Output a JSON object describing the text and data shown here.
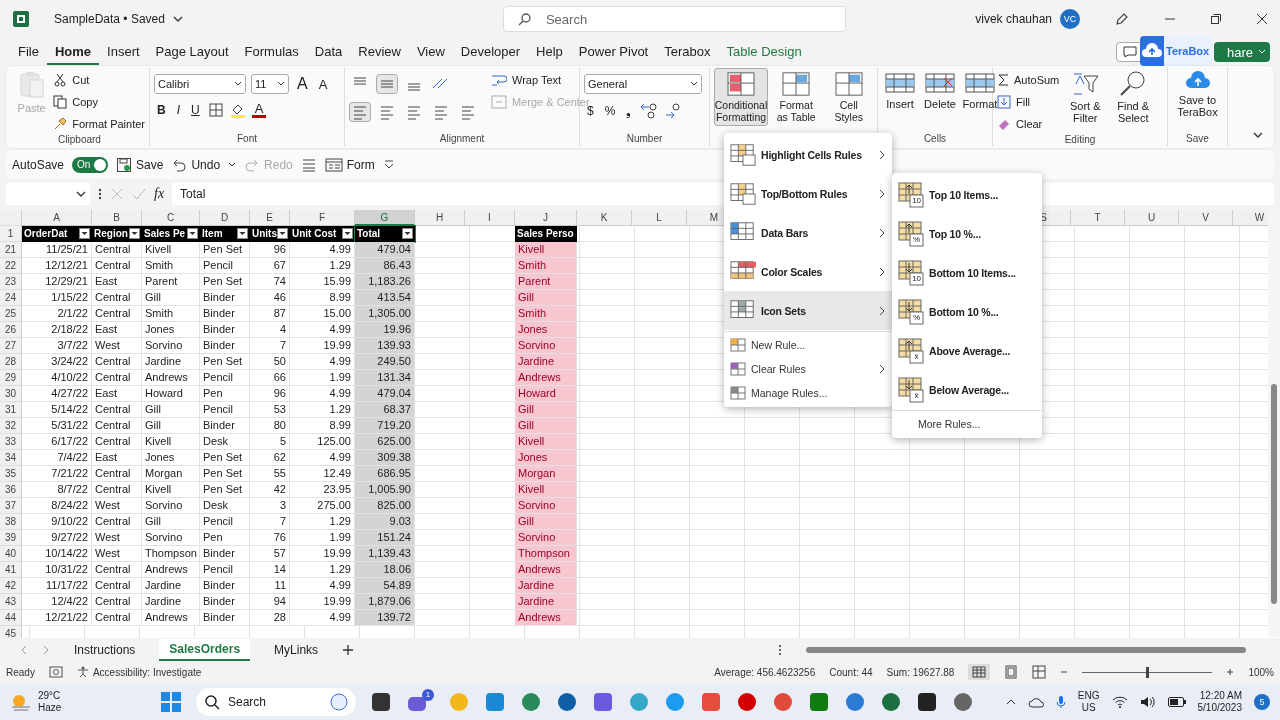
{
  "title_bar": {
    "file_name": "SampleData • Saved",
    "search_placeholder": "Search",
    "user_name": "vivek chauhan",
    "avatar_initials": "VC"
  },
  "ribbon_tabs": [
    {
      "label": "File",
      "selected": false,
      "kind": "normal"
    },
    {
      "label": "Home",
      "selected": true,
      "kind": "normal"
    },
    {
      "label": "Insert",
      "selected": false,
      "kind": "normal"
    },
    {
      "label": "Page Layout",
      "selected": false,
      "kind": "normal"
    },
    {
      "label": "Formulas",
      "selected": false,
      "kind": "normal"
    },
    {
      "label": "Data",
      "selected": false,
      "kind": "normal"
    },
    {
      "label": "Review",
      "selected": false,
      "kind": "normal"
    },
    {
      "label": "View",
      "selected": false,
      "kind": "normal"
    },
    {
      "label": "Developer",
      "selected": false,
      "kind": "normal"
    },
    {
      "label": "Help",
      "selected": false,
      "kind": "normal"
    },
    {
      "label": "Power Pivot",
      "selected": false,
      "kind": "normal"
    },
    {
      "label": "Terabox",
      "selected": false,
      "kind": "normal"
    },
    {
      "label": "Table Design",
      "selected": false,
      "kind": "contextual"
    }
  ],
  "share_button": {
    "label": "hare"
  },
  "terabox_badge": {
    "label": "TeraBox"
  },
  "ribbon": {
    "clipboard": {
      "paste": {
        "label": "Paste",
        "disabled": true
      },
      "cut": "Cut",
      "copy": "Copy",
      "format_painter": "Format Painter",
      "label": "Clipboard"
    },
    "font": {
      "family": "Calibri",
      "size": "11",
      "grow": "A",
      "shrink": "A",
      "format_buttons": [
        "B",
        "I",
        "U"
      ],
      "font_color": "A",
      "label": "Font"
    },
    "alignment": {
      "wrap_text": "Wrap Text",
      "merge_center": {
        "label": "Merge & Center",
        "disabled": true
      },
      "label": "Alignment"
    },
    "number": {
      "format": "General",
      "currency": "$",
      "percent": "%",
      "comma": "❟",
      "label": "Number"
    },
    "styles": [
      {
        "label": "Conditional Formatting",
        "selected": true
      },
      {
        "label": "Format as Table",
        "selected": false
      },
      {
        "label": "Cell Styles",
        "selected": false
      }
    ],
    "cells": {
      "buttons": [
        "Insert",
        "Delete",
        "Format"
      ],
      "label": "Cells"
    },
    "editing": {
      "autosum": "AutoSum",
      "fill": "Fill",
      "clear": "Clear",
      "sort_filter": "Sort & Filter",
      "find_select": "Find & Select",
      "label": "Editing"
    },
    "save": {
      "button": "Save to TeraBox",
      "label": "Save"
    }
  },
  "quick_access": {
    "autosave_label": "AutoSave",
    "autosave": {
      "on": true,
      "label": "On"
    },
    "save": "Save",
    "undo": "Undo",
    "redo": {
      "label": "Redo",
      "disabled": true
    },
    "form": "Form"
  },
  "formula_bar": {
    "fx": "fx",
    "content": "Total"
  },
  "sheet": {
    "columns_left": [
      {
        "letter": "A",
        "selected": false
      },
      {
        "letter": "B",
        "selected": false
      },
      {
        "letter": "C",
        "selected": false
      },
      {
        "letter": "D",
        "selected": false
      },
      {
        "letter": "E",
        "selected": false
      },
      {
        "letter": "F",
        "selected": false
      },
      {
        "letter": "G",
        "selected": true
      },
      {
        "letter": "H",
        "selected": false
      },
      {
        "letter": "I",
        "selected": false
      },
      {
        "letter": "J",
        "selected": false
      },
      {
        "letter": "K",
        "selected": false
      },
      {
        "letter": "L",
        "selected": false
      },
      {
        "letter": "M",
        "selected": false
      }
    ],
    "columns_right": [
      {
        "letter": "S",
        "selected": false
      },
      {
        "letter": "T",
        "selected": false
      },
      {
        "letter": "U",
        "selected": false
      },
      {
        "letter": "V",
        "selected": false
      },
      {
        "letter": "W",
        "selected": false
      }
    ],
    "header_row": "1",
    "headers": [
      "OrderDat",
      "Region",
      "Sales Pe",
      "Item",
      "Units",
      "Unit Cost",
      "Total"
    ],
    "side_header": "Sales Perso",
    "rows": [
      {
        "n": "21",
        "cells": [
          "11/25/21",
          "Central",
          "Kivell",
          "Pen Set",
          "96",
          "4.99",
          "479.04"
        ],
        "side": "Kivell"
      },
      {
        "n": "22",
        "cells": [
          "12/12/21",
          "Central",
          "Smith",
          "Pencil",
          "67",
          "1.29",
          "86.43"
        ],
        "side": "Smith"
      },
      {
        "n": "23",
        "cells": [
          "12/29/21",
          "East",
          "Parent",
          "Pen Set",
          "74",
          "15.99",
          "1,183.26"
        ],
        "side": "Parent"
      },
      {
        "n": "24",
        "cells": [
          "1/15/22",
          "Central",
          "Gill",
          "Binder",
          "46",
          "8.99",
          "413.54"
        ],
        "side": "Gill"
      },
      {
        "n": "25",
        "cells": [
          "2/1/22",
          "Central",
          "Smith",
          "Binder",
          "87",
          "15.00",
          "1,305.00"
        ],
        "side": "Smith"
      },
      {
        "n": "26",
        "cells": [
          "2/18/22",
          "East",
          "Jones",
          "Binder",
          "4",
          "4.99",
          "19.96"
        ],
        "side": "Jones"
      },
      {
        "n": "27",
        "cells": [
          "3/7/22",
          "West",
          "Sorvino",
          "Binder",
          "7",
          "19.99",
          "139.93"
        ],
        "side": "Sorvino"
      },
      {
        "n": "28",
        "cells": [
          "3/24/22",
          "Central",
          "Jardine",
          "Pen Set",
          "50",
          "4.99",
          "249.50"
        ],
        "side": "Jardine"
      },
      {
        "n": "29",
        "cells": [
          "4/10/22",
          "Central",
          "Andrews",
          "Pencil",
          "66",
          "1.99",
          "131.34"
        ],
        "side": "Andrews"
      },
      {
        "n": "30",
        "cells": [
          "4/27/22",
          "East",
          "Howard",
          "Pen",
          "96",
          "4.99",
          "479.04"
        ],
        "side": "Howard"
      },
      {
        "n": "31",
        "cells": [
          "5/14/22",
          "Central",
          "Gill",
          "Pencil",
          "53",
          "1.29",
          "68.37"
        ],
        "side": "Gill"
      },
      {
        "n": "32",
        "cells": [
          "5/31/22",
          "Central",
          "Gill",
          "Binder",
          "80",
          "8.99",
          "719.20"
        ],
        "side": "Gill"
      },
      {
        "n": "33",
        "cells": [
          "6/17/22",
          "Central",
          "Kivell",
          "Desk",
          "5",
          "125.00",
          "625.00"
        ],
        "side": "Kivell"
      },
      {
        "n": "34",
        "cells": [
          "7/4/22",
          "East",
          "Jones",
          "Pen Set",
          "62",
          "4.99",
          "309.38"
        ],
        "side": "Jones"
      },
      {
        "n": "35",
        "cells": [
          "7/21/22",
          "Central",
          "Morgan",
          "Pen Set",
          "55",
          "12.49",
          "686.95"
        ],
        "side": "Morgan"
      },
      {
        "n": "36",
        "cells": [
          "8/7/22",
          "Central",
          "Kivell",
          "Pen Set",
          "42",
          "23.95",
          "1,005.90"
        ],
        "side": "Kivell"
      },
      {
        "n": "37",
        "cells": [
          "8/24/22",
          "West",
          "Sorvino",
          "Desk",
          "3",
          "275.00",
          "825.00"
        ],
        "side": "Sorvino"
      },
      {
        "n": "38",
        "cells": [
          "9/10/22",
          "Central",
          "Gill",
          "Pencil",
          "7",
          "1.29",
          "9.03"
        ],
        "side": "Gill"
      },
      {
        "n": "39",
        "cells": [
          "9/27/22",
          "West",
          "Sorvino",
          "Pen",
          "76",
          "1.99",
          "151.24"
        ],
        "side": "Sorvino"
      },
      {
        "n": "40",
        "cells": [
          "10/14/22",
          "West",
          "Thompson",
          "Binder",
          "57",
          "19.99",
          "1,139.43"
        ],
        "side": "Thompson"
      },
      {
        "n": "41",
        "cells": [
          "10/31/22",
          "Central",
          "Andrews",
          "Pencil",
          "14",
          "1.29",
          "18.06"
        ],
        "side": "Andrews"
      },
      {
        "n": "42",
        "cells": [
          "11/17/22",
          "Central",
          "Jardine",
          "Binder",
          "11",
          "4.99",
          "54.89"
        ],
        "side": "Jardine"
      },
      {
        "n": "43",
        "cells": [
          "12/4/22",
          "Central",
          "Jardine",
          "Binder",
          "94",
          "19.99",
          "1,879.06"
        ],
        "side": "Jardine"
      },
      {
        "n": "44",
        "cells": [
          "12/21/22",
          "Central",
          "Andrews",
          "Binder",
          "28",
          "4.99",
          "139.72"
        ],
        "side": "Andrews"
      }
    ],
    "last_row": "45"
  },
  "conditional_menu": [
    {
      "kind": "large",
      "label": "Highlight Cells Rules",
      "submenu": true,
      "selected": false
    },
    {
      "kind": "large",
      "label": "Top/Bottom Rules",
      "submenu": true,
      "selected": false
    },
    {
      "kind": "large",
      "label": "Data Bars",
      "submenu": true,
      "selected": false
    },
    {
      "kind": "large",
      "label": "Color Scales",
      "submenu": true,
      "selected": false
    },
    {
      "kind": "large",
      "label": "Icon Sets",
      "submenu": true,
      "selected": true
    },
    {
      "kind": "small",
      "label": "New Rule...",
      "submenu": false,
      "selected": false
    },
    {
      "kind": "small",
      "label": "Clear Rules",
      "submenu": true,
      "selected": false
    },
    {
      "kind": "small",
      "label": "Manage Rules...",
      "submenu": false,
      "selected": false
    }
  ],
  "top_bottom_menu": [
    {
      "kind": "large",
      "label": "Top 10 Items...",
      "mark": "10"
    },
    {
      "kind": "large",
      "label": "Top 10 %...",
      "mark": "%"
    },
    {
      "kind": "large",
      "label": "Bottom 10 Items...",
      "mark": "10"
    },
    {
      "kind": "large",
      "label": "Bottom 10 %...",
      "mark": "%"
    },
    {
      "kind": "large",
      "label": "Above Average...",
      "mark": "x̄"
    },
    {
      "kind": "large",
      "label": "Below Average...",
      "mark": "x̄"
    },
    {
      "kind": "small",
      "label": "More Rules..."
    }
  ],
  "sheet_tabs": [
    {
      "label": "Instructions",
      "selected": false
    },
    {
      "label": "SalesOrders",
      "selected": true
    },
    {
      "label": "MyLinks",
      "selected": false
    }
  ],
  "status_bar": {
    "ready": "Ready",
    "accessibility": "Accessibility: Investigate",
    "average": "Average: 456.4623256",
    "count": "Count: 44",
    "sum": "Sum: 19627.88",
    "zoom": {
      "level": 0.5,
      "label": "100%"
    }
  },
  "taskbar": {
    "temperature": "29°C",
    "weather": "Haze",
    "search": "Search",
    "chat_badge": "1",
    "language": "ENG",
    "region": "US",
    "time": "12:20 AM",
    "date": "5/10/2023",
    "notifications": "5"
  }
}
